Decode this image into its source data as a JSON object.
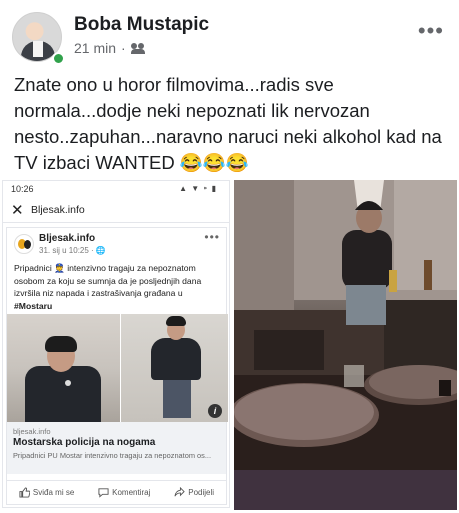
{
  "post": {
    "author": "Boba Mustapic",
    "time": "21 min",
    "separator": "·",
    "audience_icon": "friends-icon",
    "more_label": "•••",
    "text": "Znate ono u horor filmovima...radis sve normala...dodje neki nepoznati lik nervozan nesto..zapuhan...naravno naruci neki alkohol kad na TV izbaci WANTED 😂😂😂"
  },
  "embedded_screenshot": {
    "status_time": "10:26",
    "status_icons": "▲ ▼ ⁍ ▮",
    "close_label": "✕",
    "title": "Bljesak.info",
    "card": {
      "page_name": "Bljesak.info",
      "page_meta": "31. sij u 10:25 · 🌐",
      "more_label": "•••",
      "text_before": "Pripadnici 👮 intenzivno tragaju za nepoznatom osobom za koju se sumnja da je posljednjih dana izvršila niz napada i zastrašivanja građana u ",
      "hashtag": "#Mostaru",
      "info_badge": "i",
      "link": {
        "domain": "bljesak.info",
        "title": "Mostarska policija na nogama",
        "description": "Pripadnici PU Mostar intenzivno tragaju za nepoznatom os..."
      },
      "actions": {
        "like": "Sviđa mi se",
        "comment": "Komentiraj",
        "share": "Podijeli"
      }
    }
  },
  "colors": {
    "online": "#31a24c",
    "text": "#1c1e21",
    "secondary_text": "#65676b"
  }
}
